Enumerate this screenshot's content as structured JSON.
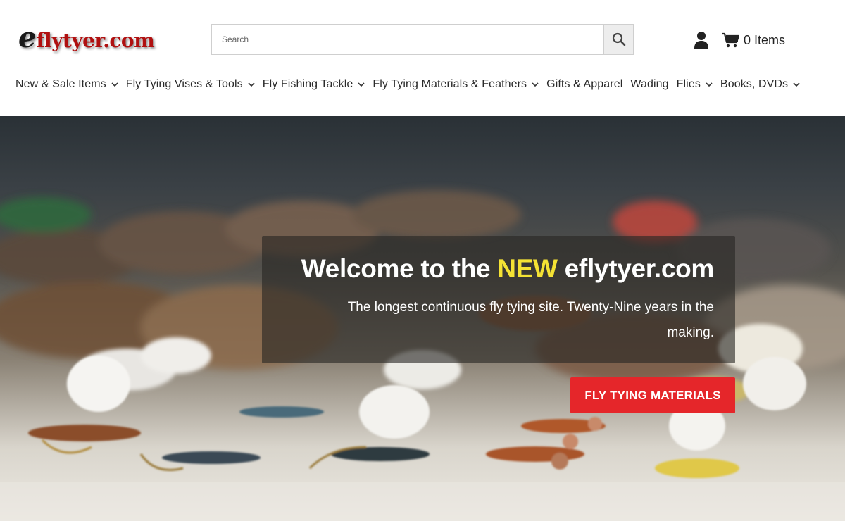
{
  "logo": {
    "initial": "e",
    "text": "flytyer.com"
  },
  "search": {
    "placeholder": "Search",
    "icon": "search-icon"
  },
  "account": {
    "icon": "user-icon"
  },
  "cart": {
    "icon": "cart-icon",
    "label": "0 Items"
  },
  "nav": {
    "items": [
      {
        "label": "New & Sale Items",
        "dropdown": true
      },
      {
        "label": "Fly Tying Vises & Tools",
        "dropdown": true
      },
      {
        "label": "Fly Fishing Tackle",
        "dropdown": true
      },
      {
        "label": "Fly Tying Materials & Feathers",
        "dropdown": true
      },
      {
        "label": "Gifts & Apparel",
        "dropdown": false
      },
      {
        "label": "Wading",
        "dropdown": false
      },
      {
        "label": "Flies",
        "dropdown": true
      },
      {
        "label": "Books, DVDs",
        "dropdown": true
      }
    ]
  },
  "hero": {
    "title_prefix": "Welcome to the ",
    "title_highlight": "NEW",
    "title_suffix": " eflytyer.com",
    "subtitle": "The longest continuous fly tying site. Twenty-Nine years in the making.",
    "cta_label": "FLY TYING MATERIALS",
    "colors": {
      "highlight": "#f4e234",
      "cta": "#e5262a"
    }
  }
}
